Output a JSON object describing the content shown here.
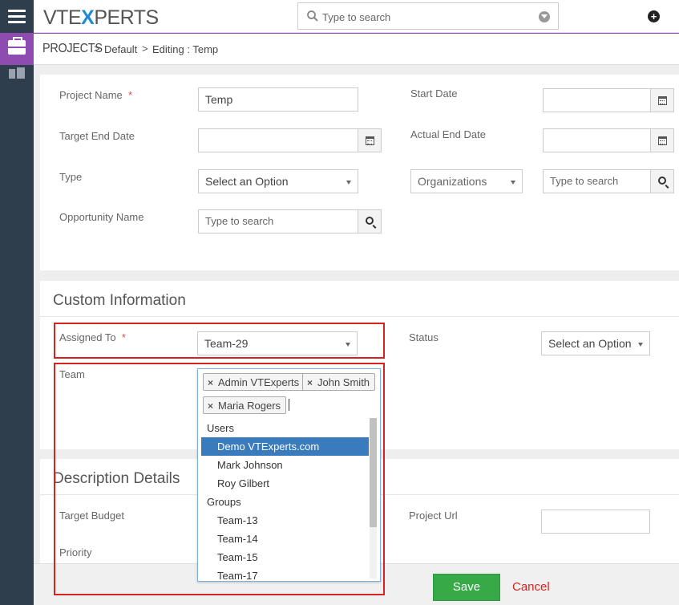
{
  "app": {
    "logo_left": "VTE",
    "logo_x": "X",
    "logo_right": "PERTS",
    "search_placeholder": "Type to search"
  },
  "breadcrumb": {
    "module": "PROJECTS",
    "separator": ">",
    "item1": "Default",
    "item2": "Editing : Temp"
  },
  "basic": {
    "project_name_label": "Project Name",
    "project_name_value": "Temp",
    "start_date_label": "Start Date",
    "target_end_date_label": "Target End Date",
    "actual_end_date_label": "Actual End Date",
    "type_label": "Type",
    "type_value": "Select an Option",
    "org_select_value": "Organizations",
    "org_search_placeholder": "Type to search",
    "opportunity_label": "Opportunity Name",
    "opportunity_placeholder": "Type to search",
    "required_mark": "*"
  },
  "custom": {
    "header": "Custom Information",
    "assigned_to_label": "Assigned To",
    "assigned_to_value": "Team-29",
    "status_label": "Status",
    "status_value": "Select an Option",
    "team_label": "Team",
    "team_chips": [
      "Admin VTExperts",
      "John Smith",
      "Maria Rogers"
    ],
    "chip_remove": "×",
    "dropdown": {
      "users_group": "Users",
      "users": [
        "Demo VTExperts.com",
        "Mark Johnson",
        "Roy Gilbert"
      ],
      "groups_group": "Groups",
      "groups": [
        "Team-13",
        "Team-14",
        "Team-15",
        "Team-17"
      ],
      "highlighted": "Demo VTExperts.com"
    }
  },
  "description": {
    "header": "Description Details",
    "target_budget_label": "Target Budget",
    "project_url_label": "Project Url",
    "priority_label": "Priority"
  },
  "footer": {
    "save_label": "Save",
    "cancel_label": "Cancel"
  },
  "colors": {
    "accent_purple": "#8e4cb1",
    "rail_dark": "#2f3e4d",
    "save_green": "#35aa47",
    "highlight_red": "#d9221f",
    "selection_blue": "#3a7bbd"
  }
}
